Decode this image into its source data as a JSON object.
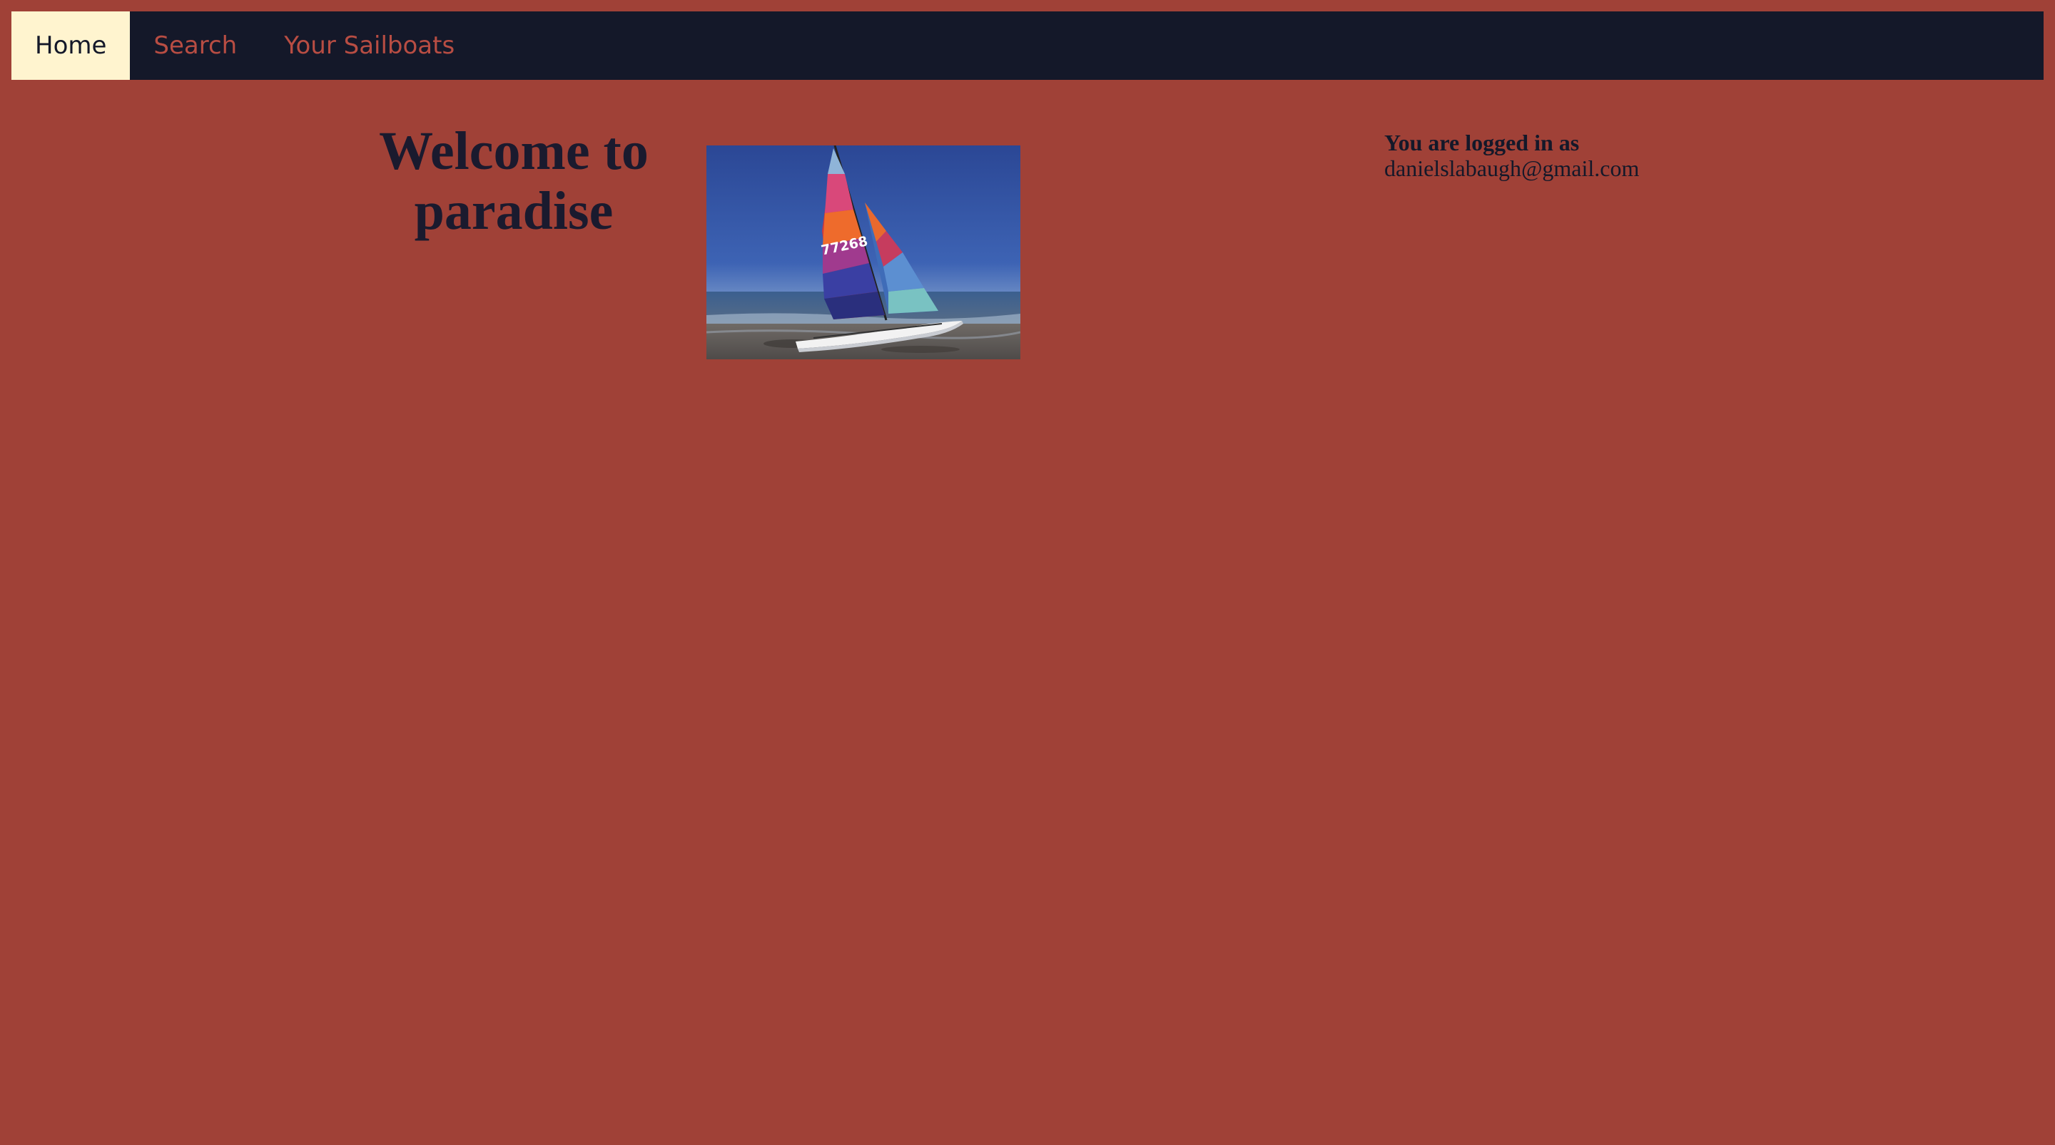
{
  "nav": {
    "items": [
      {
        "label": "Home",
        "active": true
      },
      {
        "label": "Search",
        "active": false
      },
      {
        "label": "Your Sailboats",
        "active": false
      }
    ]
  },
  "hero": {
    "title": "Welcome to paradise",
    "image_icon": "catamaran-sailboat-photo",
    "sail_number": "77268"
  },
  "user": {
    "label": "You are logged in as",
    "email": "danielslabaugh@gmail.com"
  },
  "colors": {
    "page_background": "#a04137",
    "navbar_background": "#141829",
    "nav_active_background": "#fff4cf",
    "nav_inactive_text": "#b84d43",
    "heading_text": "#1a1a2e"
  }
}
